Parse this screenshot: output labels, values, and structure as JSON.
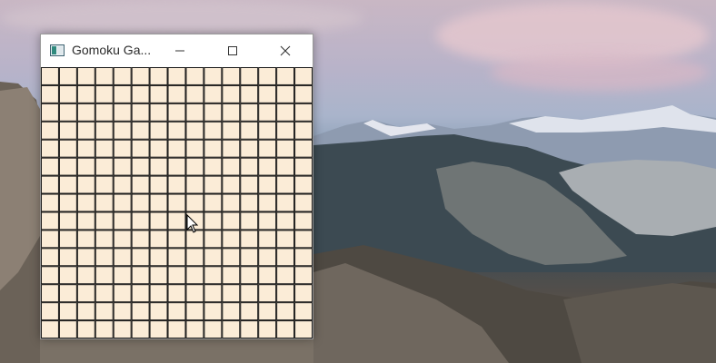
{
  "window": {
    "title": "Gomoku Ga...",
    "minimize_glyph": "minimize-icon",
    "maximize_glyph": "maximize-icon",
    "close_glyph": "close-icon"
  },
  "board": {
    "columns": 15,
    "rows": 15,
    "background": "#fbecd7",
    "line_color": "#1a1a1a"
  },
  "desktop": {
    "wallpaper": "mountain-landscape"
  }
}
